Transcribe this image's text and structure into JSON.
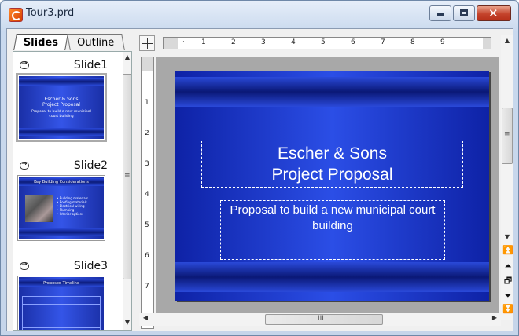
{
  "window": {
    "title": "Tour3.prd",
    "min_label": "",
    "max_label": "",
    "close_label": "✕"
  },
  "tabs": {
    "slides": "Slides",
    "outline": "Outline"
  },
  "slides": [
    {
      "label": "Slide1",
      "title_lines": [
        "Escher & Sons",
        "Project Proposal"
      ],
      "subtitle": "Proposal to build a new municipal court building"
    },
    {
      "label": "Slide2",
      "title": "Key Building Considerations",
      "bullets": [
        "• Building materials",
        "• Roofing materials",
        "• Electrical wiring",
        "• Plumbing",
        "• Interior options"
      ]
    },
    {
      "label": "Slide3",
      "title": "Proposed Timeline"
    }
  ],
  "main_slide": {
    "title_line1": "Escher & Sons",
    "title_line2": "Project Proposal",
    "subtitle": "Proposal to build a new municipal court building"
  },
  "hruler_ticks": [
    "1",
    "2",
    "3",
    "4",
    "5",
    "6",
    "7",
    "8",
    "9"
  ],
  "vruler_ticks": [
    "1",
    "2",
    "3",
    "4",
    "5",
    "6",
    "7"
  ],
  "scroll": {
    "left_grip": "≡",
    "right_grip": "≡",
    "h_grip": "III"
  },
  "nav": {
    "first": "⏫",
    "prev": "⏶",
    "dup": "🗗",
    "next": "⏷",
    "last": "⏬"
  },
  "colors": {
    "slide_blue": "#2b4ee6",
    "slide_dark": "#0e22a6"
  }
}
